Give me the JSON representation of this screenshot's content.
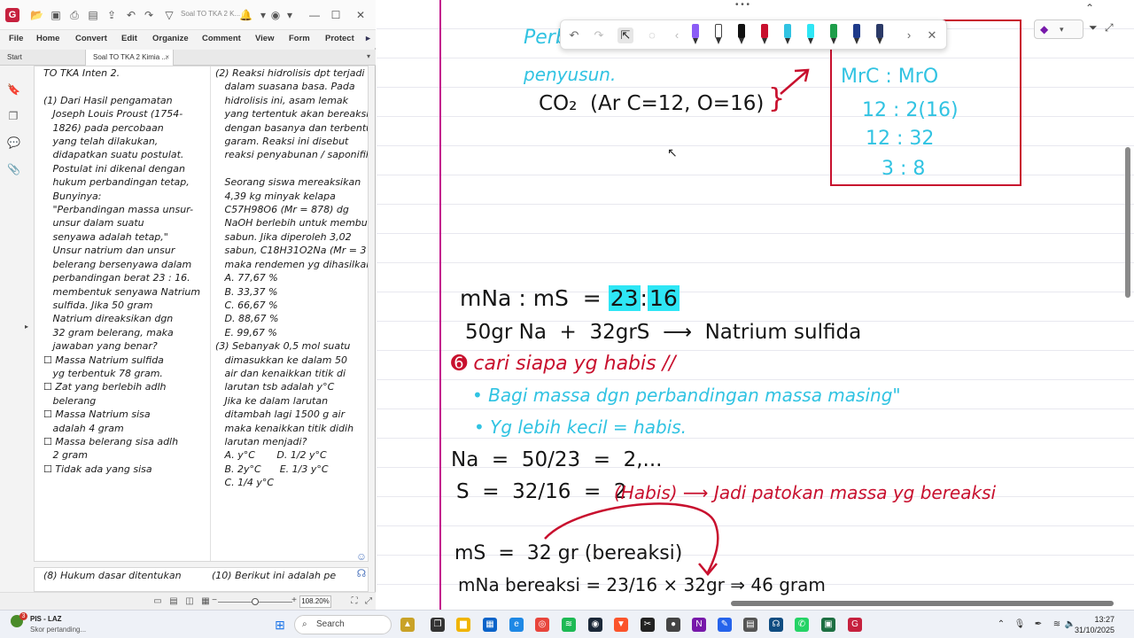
{
  "window": {
    "doc_title": "Soal TO TKA 2 K...",
    "app_logo": "G"
  },
  "menu": [
    "File",
    "Home",
    "Convert",
    "Edit",
    "Organize",
    "Comment",
    "View",
    "Form",
    "Protect"
  ],
  "tabs": [
    {
      "label": "Start"
    },
    {
      "label": "Soal TO TKA 2 Kimia ..."
    }
  ],
  "pdf": {
    "col1": "TO TKA Inten 2.\n\n(1) Dari Hasil pengamatan\n   Joseph Louis Proust (1754-\n   1826) pada percobaan\n   yang telah dilakukan,\n   didapatkan suatu postulat.\n   Postulat ini dikenal dengan\n   hukum perbandingan tetap,\n   Bunyinya:\n   \"Perbandingan massa unsur-\n   unsur dalam suatu\n   senyawa adalah tetap,\"\n   Unsur natrium dan unsur\n   belerang bersenyawa dalam\n   perbandingan berat 23 : 16.\n   membentuk senyawa Natrium\n   sulfida. Jika 50 gram\n   Natrium direaksikan dgn\n   32 gram belerang, maka\n   jawaban yang benar?\n☐ Massa Natrium sulfida\n   yg terbentuk 78 gram.\n☐ Zat yang berlebih adlh\n   belerang\n☐ Massa Natrium sisa\n   adalah 4 gram\n☐ Massa belerang sisa adlh\n   2 gram\n☐ Tidak ada yang sisa",
    "col2": "(2) Reaksi hidrolisis dpt terjadi\n   dalam suasana basa. Pada\n   hidrolisis ini, asam lemak\n   yang tertentuk akan bereaksi\n   dengan basanya dan terbentuk\n   garam. Reaksi ini disebut\n   reaksi penyabunan / saponifikasi\n\n   Seorang siswa mereaksikan\n   4,39 kg minyak kelapa\n   C57H98O6 (Mr = 878) dg\n   NaOH berlebih untuk membuat\n   sabun. Jika diperoleh 3,02\n   sabun, C18H31O2Na (Mr = 3\n   maka rendemen yg dihasilkan\n   A. 77,67 %\n   B. 33,37 %\n   C. 66,67 %\n   D. 88,67 %\n   E. 99,67 %\n(3) Sebanyak 0,5 mol suatu\n   dimasukkan ke dalam 50\n   air dan kenaikkan titik di\n   larutan tsb adalah y°C\n   Jika ke dalam larutan\n   ditambah lagi 1500 g air\n   maka kenaikkan titik didih\n   larutan menjadi?\n   A. y°C       D. 1/2 y°C\n   B. 2y°C      E. 1/3 y°C\n   C. 1/4 y°C",
    "next_col1": "(8) Hukum dasar ditentukan",
    "next_col2": "(10) Berikut ini adalah pe"
  },
  "status": {
    "zoom": "108.20%"
  },
  "notes": {
    "top_cyan_1": "Perbandingan massa",
    "top_cyan_2": "penyusun.",
    "co2": "CO₂  (Ar C=12, O=16)",
    "brace": "}",
    "box_lines": [
      "MrC : MrO",
      "MrC : MrO",
      "12 : 2(16)",
      "12 : 32",
      "3 : 8"
    ],
    "ratio_left": "mNa : mS  =",
    "ratio_a": "23",
    "ratio_colon": ":",
    "ratio_b": "16",
    "reaction": "50gr Na  +  32grS  ⟶  Natrium sulfida",
    "step_title": "➏ cari siapa yg habis //",
    "bullet1": "• Bagi massa dgn perbandingan massa masing\"",
    "bullet2": "• Yg lebih kecil = habis.",
    "na_line": "Na  =  50/23  =  2,...",
    "s_line": "S  =  32/16  =  2",
    "habis": "(Habis) ⟶ Jadi patokan massa yg bereaksi",
    "ms_line": "mS  =  32 gr (bereaksi)",
    "mna_line": "mNa bereaksi = 23/16 × 32gr ⇒ 46 gram"
  },
  "taskbar": {
    "notif_title": "PIS - LAZ",
    "notif_sub": "Skor pertanding...",
    "badge": "3",
    "search_label": "Search",
    "time": "13:27",
    "date": "31/10/2025"
  }
}
